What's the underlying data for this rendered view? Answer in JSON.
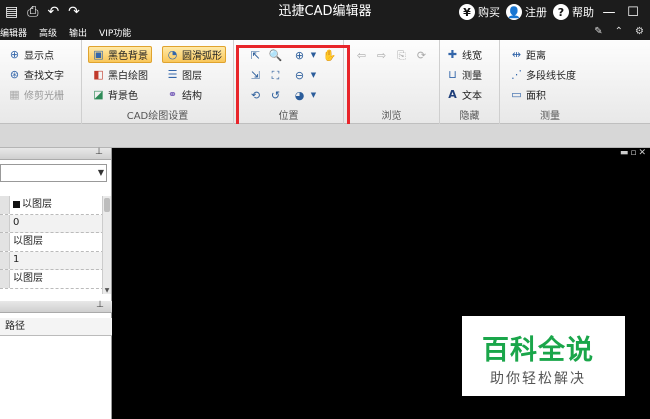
{
  "titlebar": {
    "title": "迅捷CAD编辑器",
    "buy_label": "购买",
    "register_label": "注册",
    "help_label": "帮助",
    "buy_glyph": "¥",
    "help_glyph": "?"
  },
  "menu": {
    "items": [
      "编辑器",
      "高级",
      "输出",
      "VIP功能"
    ]
  },
  "ribbon": {
    "group1": {
      "items": [
        "显示点",
        "查找文字",
        "修剪光栅"
      ]
    },
    "group2": {
      "label": "CAD绘图设置",
      "items": [
        "黑色背景",
        "圆滑弧形",
        "黑白绘图",
        "图层",
        "背景色",
        "结构"
      ]
    },
    "group3": {
      "label": "位置"
    },
    "group4": {
      "label": "浏览"
    },
    "group5": {
      "label": "隐藏",
      "items": [
        "线宽",
        "测量",
        "文本"
      ]
    },
    "group6": {
      "label": "测量",
      "items": [
        "距离",
        "多段线长度",
        "面积"
      ]
    }
  },
  "properties": {
    "rows": [
      "以图层",
      "0",
      "以图层",
      "1",
      "以图层"
    ]
  },
  "panel": {
    "path_header": "路径"
  },
  "watermark": {
    "title": "百科全说",
    "subtitle": "助你轻松解决"
  },
  "colors": {
    "highlight": "#e8252a",
    "watermark_green": "#1aa64a",
    "titlebar_bg": "#1c1c1c"
  }
}
